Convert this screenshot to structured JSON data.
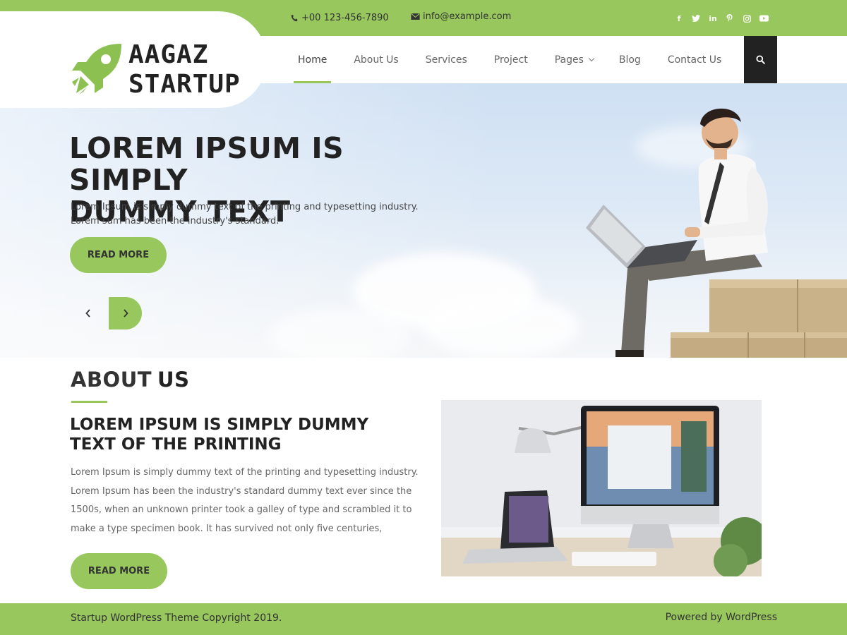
{
  "topbar": {
    "phone": "+00 123-456-7890",
    "email": "info@example.com",
    "social": [
      {
        "icon": "facebook-icon",
        "glyph": "f"
      },
      {
        "icon": "twitter-icon",
        "glyph": "t"
      },
      {
        "icon": "linkedin-icon",
        "glyph": "in"
      },
      {
        "icon": "pinterest-icon",
        "glyph": "p"
      },
      {
        "icon": "instagram-icon",
        "glyph": "◎"
      },
      {
        "icon": "youtube-icon",
        "glyph": "▶"
      }
    ]
  },
  "logo": {
    "line1": "AAGAZ",
    "line2": "STARTUP"
  },
  "nav": {
    "items": [
      {
        "label": "Home",
        "active": true
      },
      {
        "label": "About Us"
      },
      {
        "label": "Services"
      },
      {
        "label": "Project"
      },
      {
        "label": "Pages",
        "dropdown": true
      },
      {
        "label": "Blog"
      },
      {
        "label": "Contact Us"
      }
    ]
  },
  "hero": {
    "title_line1": "LOREM IPSUM IS SIMPLY",
    "title_line2": "DUMMY TEXT",
    "text": "Lorem Ipsum is simply dummy text of the printing and typesetting industry. Lorem sum has been the industry's standard.",
    "button": "READ MORE"
  },
  "about": {
    "heading_light": "ABOUT",
    "heading_bold": "US",
    "title": "LOREM IPSUM IS SIMPLY DUMMY TEXT OF THE PRINTING",
    "text": "Lorem Ipsum is simply dummy text of the printing and typesetting industry. Lorem Ipsum has been the industry's standard dummy text ever since the 1500s, when an unknown printer took a galley of type and scrambled it to make a type specimen book. It has survived not only five centuries,",
    "button": "READ MORE"
  },
  "footer": {
    "copyright": "Startup WordPress Theme Copyright 2019.",
    "powered": "Powered by WordPress"
  },
  "colors": {
    "accent": "#97c75d",
    "dark": "#222222"
  }
}
